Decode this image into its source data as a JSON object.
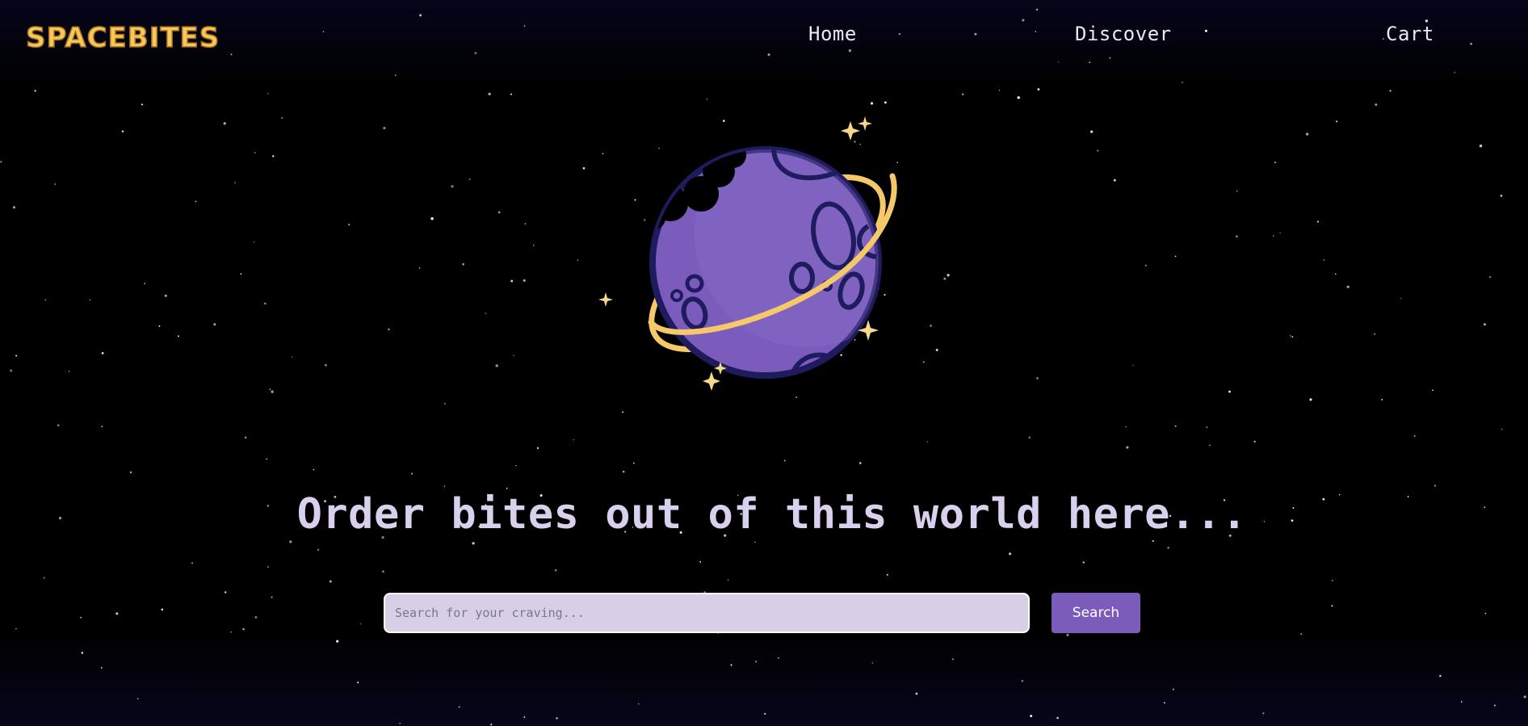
{
  "brand": {
    "logo_text": "SPACEBITES",
    "logo_color": "#f5c85a"
  },
  "nav": {
    "home_label": "Home",
    "discover_label": "Discover",
    "cart_label": "Cart"
  },
  "hero": {
    "illustration_icon": "bitten-planet-icon",
    "headline": "Order bites out of this world here..."
  },
  "search": {
    "placeholder": "Search for your craving...",
    "value": "",
    "button_label": "Search"
  },
  "colors": {
    "accent": "#7c5cbb",
    "planet": "#7b5cbd",
    "planet_outline": "#1e1b5e",
    "ring": "#f5c86a",
    "headline": "#d9d0ee",
    "background": "#000000"
  }
}
